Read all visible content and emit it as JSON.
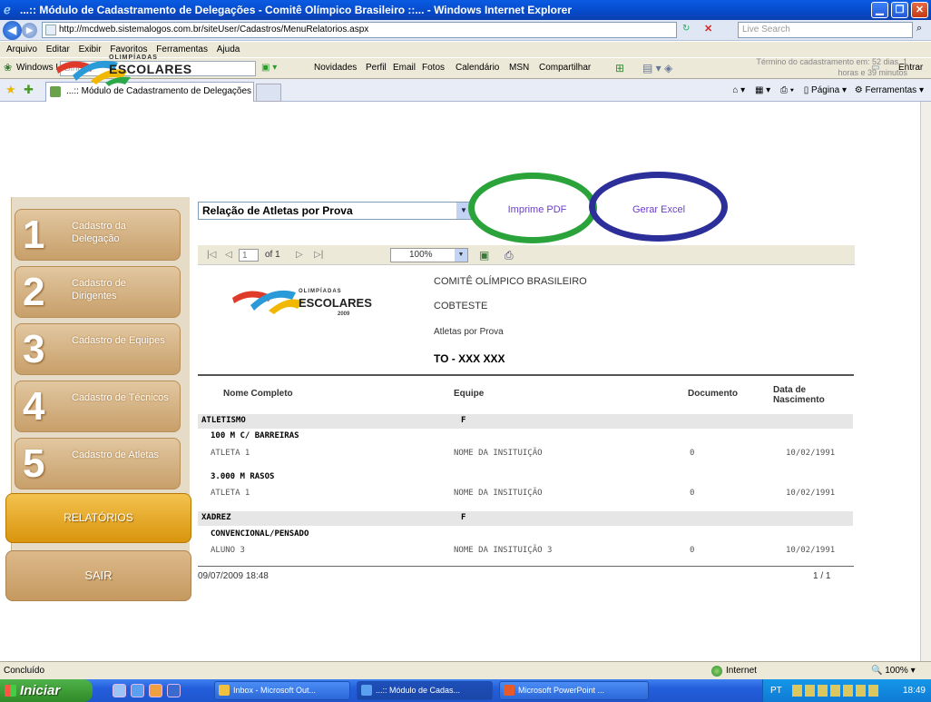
{
  "window": {
    "title": "...:: Módulo de Cadastramento de Delegações - Comitê Olímpico Brasileiro ::... - Windows Internet Explorer",
    "controls": [
      "minimize-button",
      "maximize-button",
      "close-button"
    ]
  },
  "address_bar": {
    "url": "http://mcdweb.sistemalogos.com.br/siteUser/Cadastros/MenuRelatorios.aspx",
    "search_placeholder": "Live Search"
  },
  "menu": [
    "Arquivo",
    "Editar",
    "Exibir",
    "Favoritos",
    "Ferramentas",
    "Ajuda"
  ],
  "windows_live_bar": {
    "brand": "Windows Live",
    "search_placeholder": "Bing",
    "items": [
      "Novidades",
      "Perfil",
      "Email",
      "Fotos",
      "Calendário",
      "MSN",
      "Compartilhar"
    ],
    "signin": "Entrar"
  },
  "tab": {
    "label": "...:: Módulo de Cadastramento de Delegações - Comit...",
    "page_menu": "Página",
    "tools_menu": "Ferramentas"
  },
  "header": {
    "logo_top": "OLIMPÍADAS",
    "logo_main": "ESCOLARES",
    "time_notice": "Término do cadastramento em: 52 dias, 1 horas e 39 minutos"
  },
  "sidebar": {
    "steps": [
      {
        "num": "1",
        "label": "Cadastro da Delegação"
      },
      {
        "num": "2",
        "label": "Cadastro de Dirigentes"
      },
      {
        "num": "3",
        "label": "Cadastro de Equipes"
      },
      {
        "num": "4",
        "label": "Cadastro de Técnicos"
      },
      {
        "num": "5",
        "label": "Cadastro de Atletas"
      }
    ],
    "reports": "RELATÓRIOS",
    "exit": "SAIR"
  },
  "report_controls": {
    "selected_report": "Relação de Atletas por Prova",
    "pdf_button": "Imprime PDF",
    "excel_button": "Gerar Excel"
  },
  "viewer": {
    "first": "|◁",
    "prev": "◁",
    "page_value": "1",
    "page_of": "of 1",
    "next": "▷",
    "last": "▷|",
    "zoom": "100%"
  },
  "report": {
    "logo_top": "OLIMPÍADAS",
    "logo_main": "ESCOLARES",
    "logo_year": "2009",
    "org": "COMITÊ OLÍMPICO BRASILEIRO",
    "test": "COBTESTE",
    "subtitle": "Atletas por Prova",
    "state": "TO - XXX XXX",
    "columns": [
      "Nome Completo",
      "Equipe",
      "Documento",
      "Data de Nascimento"
    ],
    "rows": [
      {
        "type": "grp",
        "name": "ATLETISMO",
        "team": "F",
        "doc": "",
        "date": ""
      },
      {
        "type": "sub",
        "name": "100 M C/ BARREIRAS",
        "team": "",
        "doc": "",
        "date": ""
      },
      {
        "type": "item",
        "name": "ATLETA 1",
        "team": "NOME DA INSITUIÇÃO",
        "doc": "0",
        "date": "10/02/1991"
      },
      {
        "type": "sub",
        "name": "3.000 M RASOS",
        "team": "",
        "doc": "",
        "date": ""
      },
      {
        "type": "item",
        "name": "ATLETA 1",
        "team": "NOME DA INSITUIÇÃO",
        "doc": "0",
        "date": "10/02/1991"
      },
      {
        "type": "grp",
        "name": "XADREZ",
        "team": "F",
        "doc": "",
        "date": ""
      },
      {
        "type": "sub",
        "name": "CONVENCIONAL/PENSADO",
        "team": "",
        "doc": "",
        "date": ""
      },
      {
        "type": "item",
        "name": "ALUNO 3",
        "team": "NOME DA INSITUIÇÃO 3",
        "doc": "0",
        "date": "10/02/1991"
      }
    ],
    "footer_date": "09/07/2009 18:48",
    "footer_page": "1 / 1"
  },
  "status": {
    "left": "Concluído",
    "zone": "Internet",
    "zoom": "100%"
  },
  "taskbar": {
    "start": "Iniciar",
    "tasks": [
      {
        "label": "Inbox - Microsoft Out...",
        "color": "#f0c040"
      },
      {
        "label": "...:: Módulo de Cadas...",
        "color": "#5aa0f0"
      },
      {
        "label": "Microsoft PowerPoint ...",
        "color": "#e85a2a"
      }
    ],
    "lang": "PT",
    "clock": "18:49"
  }
}
